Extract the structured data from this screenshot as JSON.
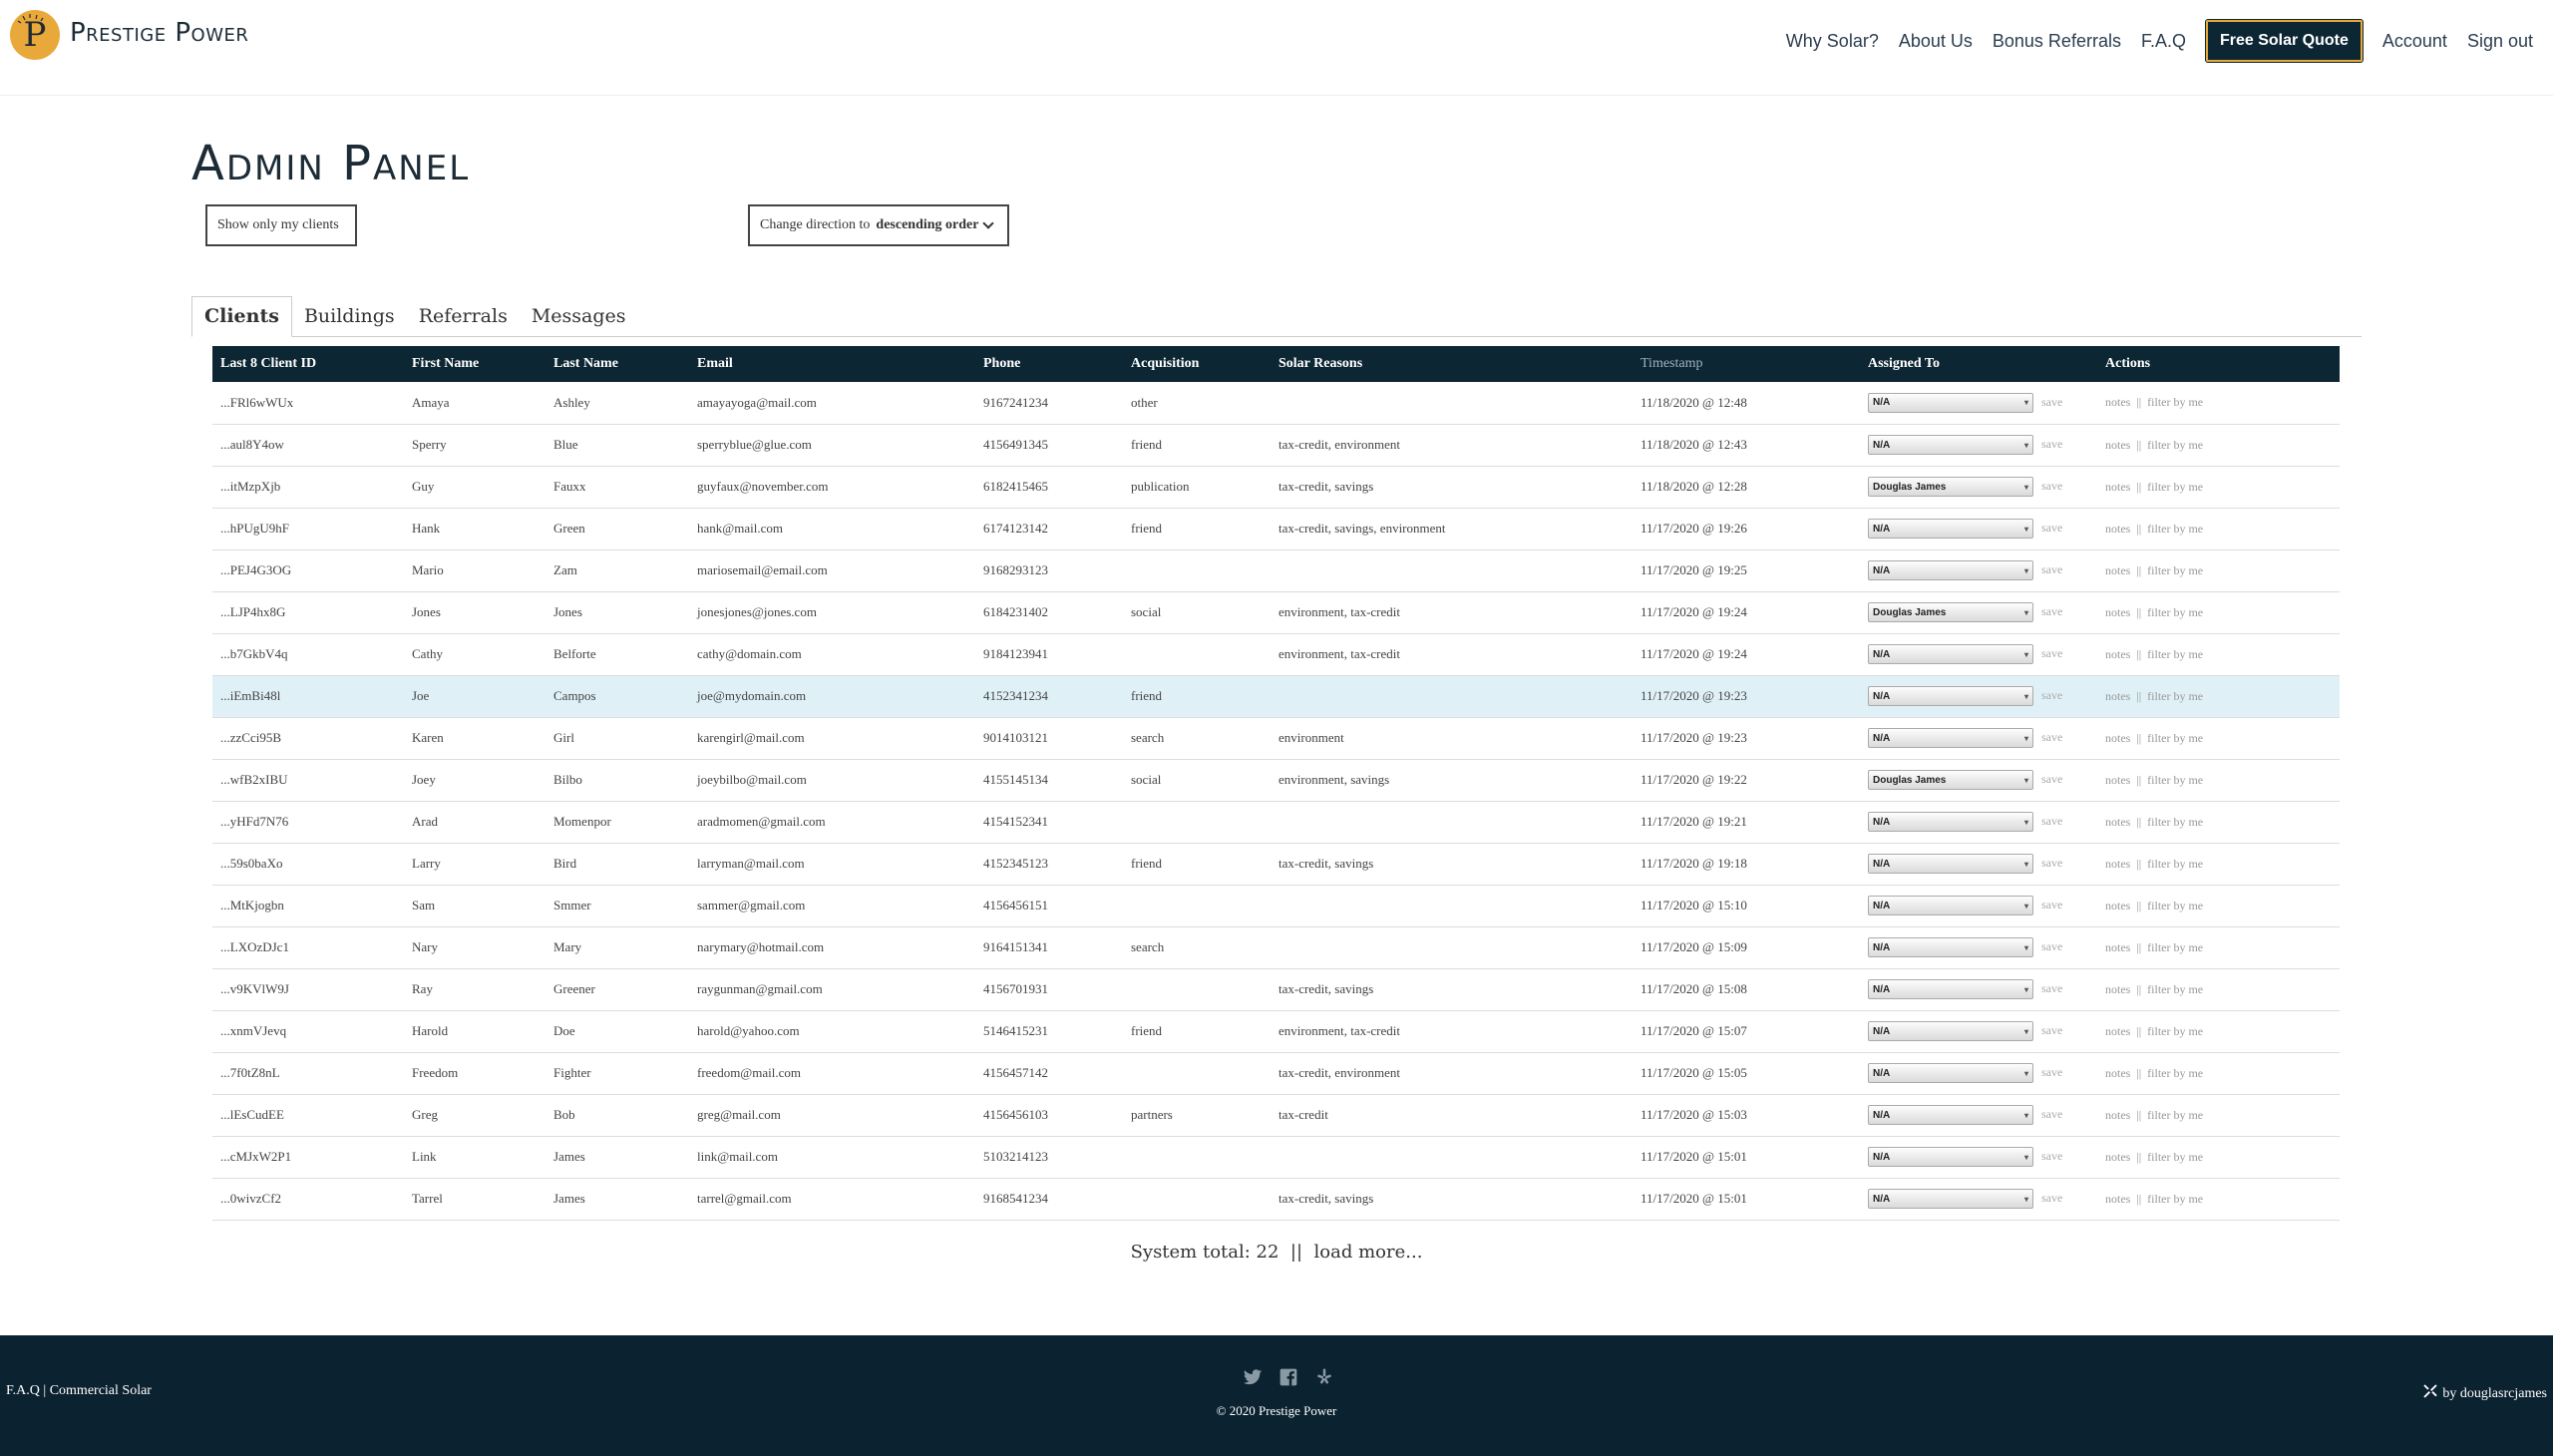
{
  "brand": {
    "name": "Prestige Power",
    "logo_letter": "P"
  },
  "nav": [
    {
      "label": "Why Solar?",
      "name": "nav-why-solar"
    },
    {
      "label": "About Us",
      "name": "nav-about-us"
    },
    {
      "label": "Bonus Referrals",
      "name": "nav-bonus-referrals"
    },
    {
      "label": "F.A.Q",
      "name": "nav-faq"
    },
    {
      "label": "Free Solar Quote",
      "name": "nav-free-solar-quote",
      "button": true
    },
    {
      "label": "Account",
      "name": "nav-account"
    },
    {
      "label": "Sign out",
      "name": "nav-sign-out"
    }
  ],
  "page": {
    "title": "Admin Panel",
    "show_mine_label": "Show only my clients",
    "direction_prefix": "Change direction to ",
    "direction_value": "descending order"
  },
  "tabs": [
    "Clients",
    "Buildings",
    "Referrals",
    "Messages"
  ],
  "table": {
    "headers": [
      "Last 8 Client ID",
      "First Name",
      "Last Name",
      "Email",
      "Phone",
      "Acquisition",
      "Solar Reasons",
      "Timestamp",
      "Assigned To",
      "Actions"
    ],
    "save_label": "save",
    "notes_label": "notes",
    "separator": "||",
    "filter_label": "filter by me",
    "rows": [
      {
        "id": "...FRl6wWUx",
        "first": "Amaya",
        "last": "Ashley",
        "email": "amayayoga@mail.com",
        "phone": "9167241234",
        "acq": "other",
        "reasons": "",
        "ts": "11/18/2020 @ 12:48",
        "assigned": "N/A"
      },
      {
        "id": "...aul8Y4ow",
        "first": "Sperry",
        "last": "Blue",
        "email": "sperryblue@glue.com",
        "phone": "4156491345",
        "acq": "friend",
        "reasons": "tax-credit, environment",
        "ts": "11/18/2020 @ 12:43",
        "assigned": "N/A"
      },
      {
        "id": "...itMzpXjb",
        "first": "Guy",
        "last": "Fauxx",
        "email": "guyfaux@november.com",
        "phone": "6182415465",
        "acq": "publication",
        "reasons": "tax-credit, savings",
        "ts": "11/18/2020 @ 12:28",
        "assigned": "Douglas James"
      },
      {
        "id": "...hPUgU9hF",
        "first": "Hank",
        "last": "Green",
        "email": "hank@mail.com",
        "phone": "6174123142",
        "acq": "friend",
        "reasons": "tax-credit, savings, environment",
        "ts": "11/17/2020 @ 19:26",
        "assigned": "N/A"
      },
      {
        "id": "...PEJ4G3OG",
        "first": "Mario",
        "last": "Zam",
        "email": "mariosemail@email.com",
        "phone": "9168293123",
        "acq": "",
        "reasons": "",
        "ts": "11/17/2020 @ 19:25",
        "assigned": "N/A"
      },
      {
        "id": "...LJP4hx8G",
        "first": "Jones",
        "last": "Jones",
        "email": "jonesjones@jones.com",
        "phone": "6184231402",
        "acq": "social",
        "reasons": "environment, tax-credit",
        "ts": "11/17/2020 @ 19:24",
        "assigned": "Douglas James"
      },
      {
        "id": "...b7GkbV4q",
        "first": "Cathy",
        "last": "Belforte",
        "email": "cathy@domain.com",
        "phone": "9184123941",
        "acq": "",
        "reasons": "environment, tax-credit",
        "ts": "11/17/2020 @ 19:24",
        "assigned": "N/A"
      },
      {
        "id": "...iEmBi48l",
        "first": "Joe",
        "last": "Campos",
        "email": "joe@mydomain.com",
        "phone": "4152341234",
        "acq": "friend",
        "reasons": "",
        "ts": "11/17/2020 @ 19:23",
        "assigned": "N/A",
        "highlight": true
      },
      {
        "id": "...zzCci95B",
        "first": "Karen",
        "last": "Girl",
        "email": "karengirl@mail.com",
        "phone": "9014103121",
        "acq": "search",
        "reasons": "environment",
        "ts": "11/17/2020 @ 19:23",
        "assigned": "N/A"
      },
      {
        "id": "...wfB2xIBU",
        "first": "Joey",
        "last": "Bilbo",
        "email": "joeybilbo@mail.com",
        "phone": "4155145134",
        "acq": "social",
        "reasons": "environment, savings",
        "ts": "11/17/2020 @ 19:22",
        "assigned": "Douglas James"
      },
      {
        "id": "...yHFd7N76",
        "first": "Arad",
        "last": "Momenpor",
        "email": "aradmomen@gmail.com",
        "phone": "4154152341",
        "acq": "",
        "reasons": "",
        "ts": "11/17/2020 @ 19:21",
        "assigned": "N/A"
      },
      {
        "id": "...59s0baXo",
        "first": "Larry",
        "last": "Bird",
        "email": "larryman@mail.com",
        "phone": "4152345123",
        "acq": "friend",
        "reasons": "tax-credit, savings",
        "ts": "11/17/2020 @ 19:18",
        "assigned": "N/A"
      },
      {
        "id": "...MtKjogbn",
        "first": "Sam",
        "last": "Smmer",
        "email": "sammer@gmail.com",
        "phone": "4156456151",
        "acq": "",
        "reasons": "",
        "ts": "11/17/2020 @ 15:10",
        "assigned": "N/A"
      },
      {
        "id": "...LXOzDJc1",
        "first": "Nary",
        "last": "Mary",
        "email": "narymary@hotmail.com",
        "phone": "9164151341",
        "acq": "search",
        "reasons": "",
        "ts": "11/17/2020 @ 15:09",
        "assigned": "N/A"
      },
      {
        "id": "...v9KVlW9J",
        "first": "Ray",
        "last": "Greener",
        "email": "raygunman@gmail.com",
        "phone": "4156701931",
        "acq": "",
        "reasons": "tax-credit, savings",
        "ts": "11/17/2020 @ 15:08",
        "assigned": "N/A"
      },
      {
        "id": "...xnmVJevq",
        "first": "Harold",
        "last": "Doe",
        "email": "harold@yahoo.com",
        "phone": "5146415231",
        "acq": "friend",
        "reasons": "environment, tax-credit",
        "ts": "11/17/2020 @ 15:07",
        "assigned": "N/A"
      },
      {
        "id": "...7f0tZ8nL",
        "first": "Freedom",
        "last": "Fighter",
        "email": "freedom@mail.com",
        "phone": "4156457142",
        "acq": "",
        "reasons": "tax-credit, environment",
        "ts": "11/17/2020 @ 15:05",
        "assigned": "N/A"
      },
      {
        "id": "...lEsCudEE",
        "first": "Greg",
        "last": "Bob",
        "email": "greg@mail.com",
        "phone": "4156456103",
        "acq": "partners",
        "reasons": "tax-credit",
        "ts": "11/17/2020 @ 15:03",
        "assigned": "N/A"
      },
      {
        "id": "...cMJxW2P1",
        "first": "Link",
        "last": "James",
        "email": "link@mail.com",
        "phone": "5103214123",
        "acq": "",
        "reasons": "",
        "ts": "11/17/2020 @ 15:01",
        "assigned": "N/A"
      },
      {
        "id": "...0wivzCf2",
        "first": "Tarrel",
        "last": "James",
        "email": "tarrel@gmail.com",
        "phone": "9168541234",
        "acq": "",
        "reasons": "tax-credit, savings",
        "ts": "11/17/2020 @ 15:01",
        "assigned": "N/A"
      }
    ]
  },
  "summary": {
    "total_label": "System total: 22",
    "separator": "||",
    "load_more": "load more..."
  },
  "footer": {
    "faq": "F.A.Q",
    "divider": "|",
    "commercial": "Commercial Solar",
    "copyright": "© 2020 Prestige Power",
    "credit": "by douglasrcjames",
    "social_icons": [
      "twitter-icon",
      "facebook-icon",
      "yelp-icon"
    ]
  },
  "colors": {
    "navy": "#0d2633",
    "gold": "#e9a93a",
    "highlight_row": "#dff1f7"
  }
}
